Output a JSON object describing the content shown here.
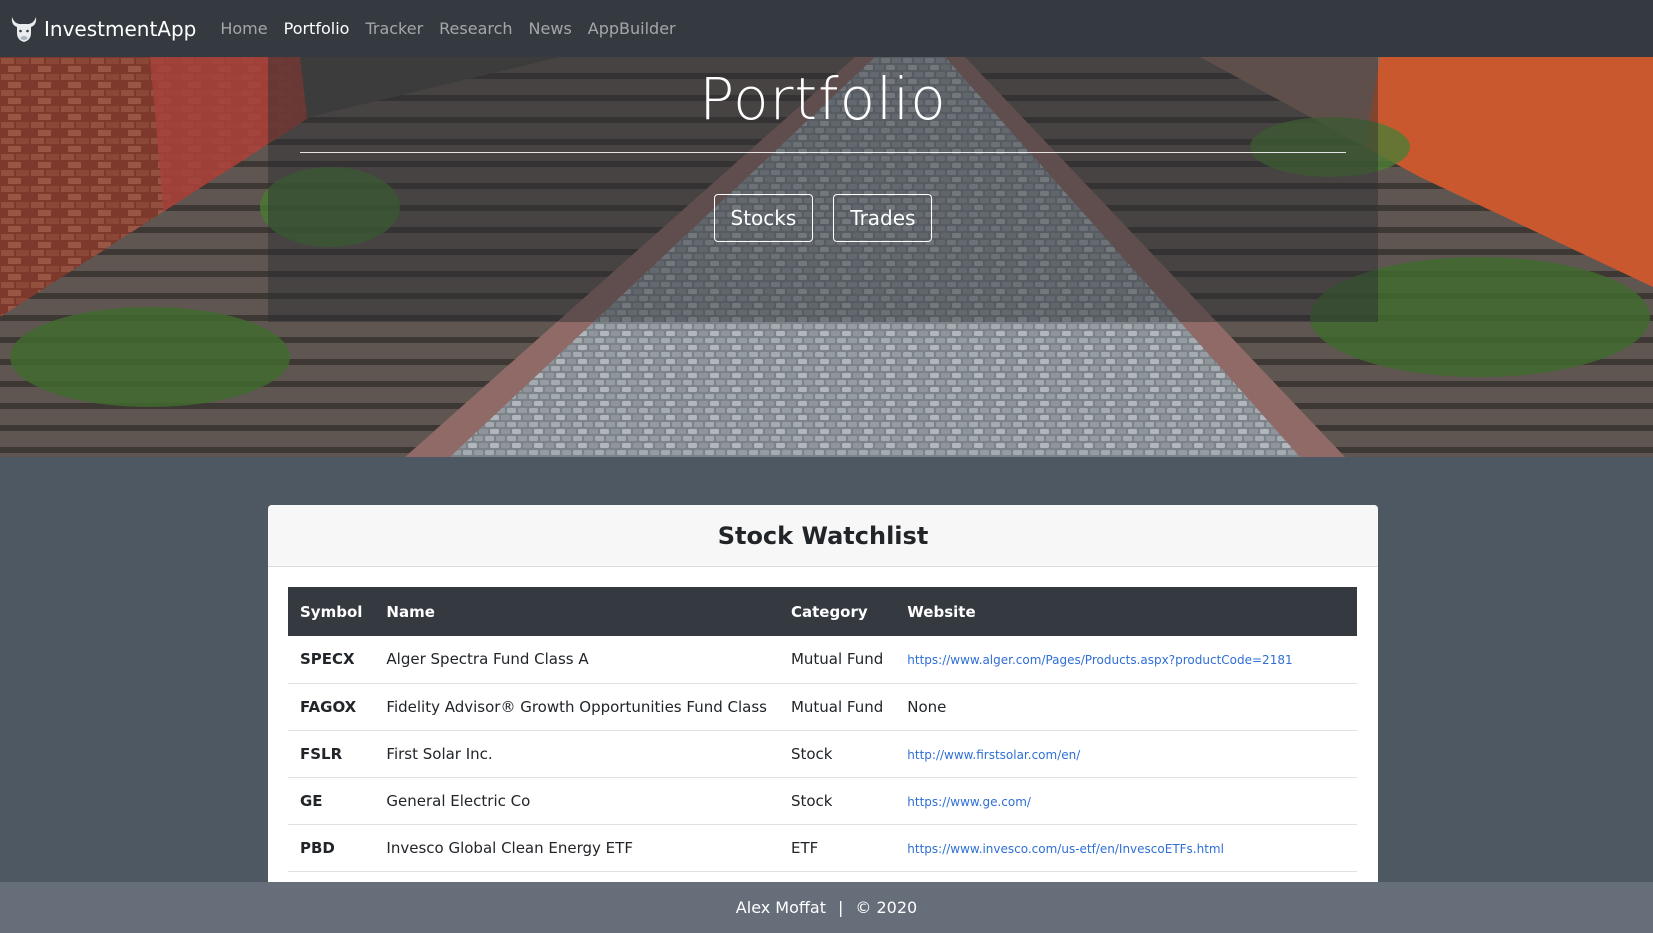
{
  "navbar": {
    "brand": "InvestmentApp",
    "items": [
      {
        "label": "Home",
        "active": false
      },
      {
        "label": "Portfolio",
        "active": true
      },
      {
        "label": "Tracker",
        "active": false
      },
      {
        "label": "Research",
        "active": false
      },
      {
        "label": "News",
        "active": false
      },
      {
        "label": "AppBuilder",
        "active": false
      }
    ]
  },
  "hero": {
    "title": "Portfolio",
    "buttons": [
      "Stocks",
      "Trades"
    ]
  },
  "watchlist": {
    "title": "Stock Watchlist",
    "columns": [
      "Symbol",
      "Name",
      "Category",
      "Website"
    ],
    "rows": [
      {
        "symbol": "SPECX",
        "name": "Alger Spectra Fund Class A",
        "category": "Mutual Fund",
        "website": "https://www.alger.com/Pages/Products.aspx?productCode=2181",
        "is_link": true
      },
      {
        "symbol": "FAGOX",
        "name": "Fidelity Advisor® Growth Opportunities Fund Class",
        "category": "Mutual Fund",
        "website": "None",
        "is_link": false
      },
      {
        "symbol": "FSLR",
        "name": "First Solar Inc.",
        "category": "Stock",
        "website": "http://www.firstsolar.com/en/",
        "is_link": true
      },
      {
        "symbol": "GE",
        "name": "General Electric Co",
        "category": "Stock",
        "website": "https://www.ge.com/",
        "is_link": true
      },
      {
        "symbol": "PBD",
        "name": "Invesco Global Clean Energy ETF",
        "category": "ETF",
        "website": "https://www.invesco.com/us-etf/en/InvescoETFs.html",
        "is_link": true
      }
    ]
  },
  "footer": {
    "author": "Alex Moffat",
    "separator": "|",
    "copyright": "© 2020"
  },
  "colors": {
    "navbar_bg": "#343a40",
    "page_bg": "#4e5862",
    "footer_bg": "#666f79",
    "link": "#2f6fd6"
  }
}
